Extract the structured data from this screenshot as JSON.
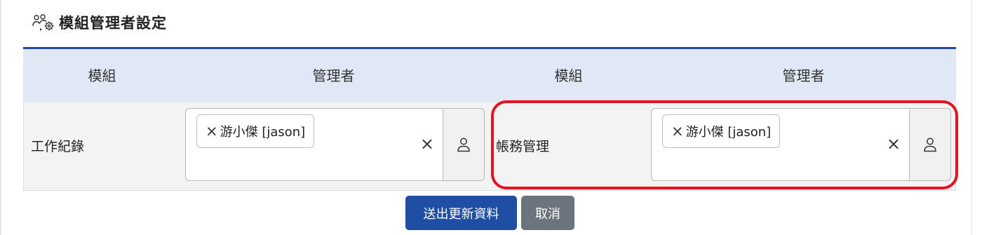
{
  "page": {
    "title": "模組管理者設定",
    "title_icon": "users-gear-icon"
  },
  "table": {
    "headers": [
      "模組",
      "管理者",
      "模組",
      "管理者"
    ],
    "rows": [
      {
        "left": {
          "module": "工作紀錄",
          "manager_chip": "游小傑 [jason]",
          "chip_remove": "×",
          "clear": "×"
        },
        "right": {
          "module": "帳務管理",
          "manager_chip": "游小傑 [jason]",
          "chip_remove": "×",
          "clear": "×"
        }
      }
    ]
  },
  "highlight_color": "#e8131b",
  "buttons": {
    "submit_label": "送出更新資料",
    "cancel_label": "取消"
  },
  "colors": {
    "primary": "#1e4fa5",
    "secondary": "#6c757d",
    "header_bg": "#e1e8f5",
    "table_rule": "#1f4ba0"
  }
}
